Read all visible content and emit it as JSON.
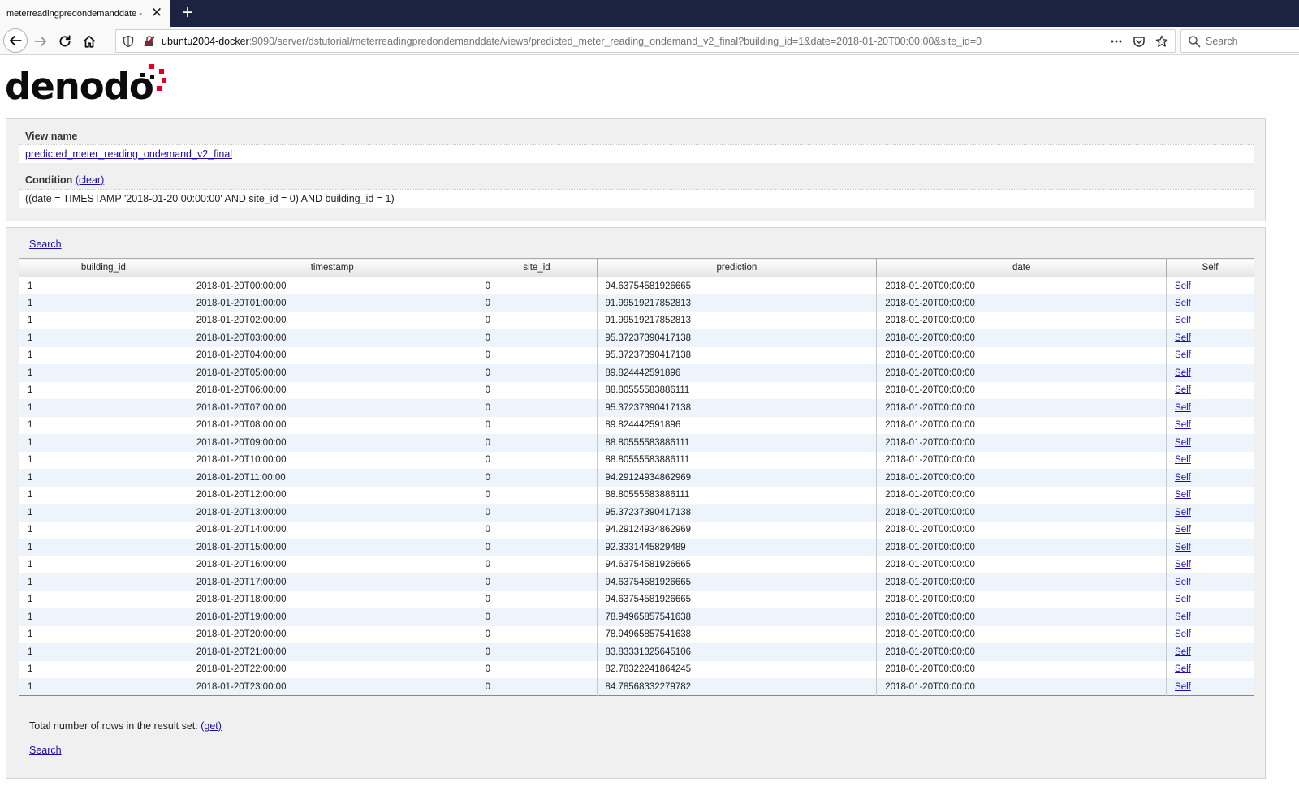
{
  "browser": {
    "tab_title": "meterreadingpredondemanddate - ",
    "url_host": "ubuntu2004-docker",
    "url_rest": ":9090/server/dstutorial/meterreadingpredondemanddate/views/predicted_meter_reading_ondemand_v2_final?building_id=1&date=2018-01-20T00:00:00&site_id=0",
    "search_placeholder": "Search"
  },
  "logo": {
    "text": "denodo"
  },
  "view": {
    "name_label": "View name",
    "name_value": "predicted_meter_reading_ondemand_v2_final",
    "condition_label": "Condition",
    "clear_label": "(clear)",
    "condition_value": "((date = TIMESTAMP '2018-01-20 00:00:00' AND site_id = 0) AND building_id = 1)"
  },
  "results": {
    "search_label": "Search",
    "total_label": "Total number of rows in the result set:",
    "get_label": "(get)",
    "columns": [
      "building_id",
      "timestamp",
      "site_id",
      "prediction",
      "date",
      "Self"
    ],
    "rows": [
      [
        "1",
        "2018-01-20T00:00:00",
        "0",
        "94.63754581926665",
        "2018-01-20T00:00:00",
        "Self"
      ],
      [
        "1",
        "2018-01-20T01:00:00",
        "0",
        "91.99519217852813",
        "2018-01-20T00:00:00",
        "Self"
      ],
      [
        "1",
        "2018-01-20T02:00:00",
        "0",
        "91.99519217852813",
        "2018-01-20T00:00:00",
        "Self"
      ],
      [
        "1",
        "2018-01-20T03:00:00",
        "0",
        "95.37237390417138",
        "2018-01-20T00:00:00",
        "Self"
      ],
      [
        "1",
        "2018-01-20T04:00:00",
        "0",
        "95.37237390417138",
        "2018-01-20T00:00:00",
        "Self"
      ],
      [
        "1",
        "2018-01-20T05:00:00",
        "0",
        "89.824442591896",
        "2018-01-20T00:00:00",
        "Self"
      ],
      [
        "1",
        "2018-01-20T06:00:00",
        "0",
        "88.80555583886111",
        "2018-01-20T00:00:00",
        "Self"
      ],
      [
        "1",
        "2018-01-20T07:00:00",
        "0",
        "95.37237390417138",
        "2018-01-20T00:00:00",
        "Self"
      ],
      [
        "1",
        "2018-01-20T08:00:00",
        "0",
        "89.824442591896",
        "2018-01-20T00:00:00",
        "Self"
      ],
      [
        "1",
        "2018-01-20T09:00:00",
        "0",
        "88.80555583886111",
        "2018-01-20T00:00:00",
        "Self"
      ],
      [
        "1",
        "2018-01-20T10:00:00",
        "0",
        "88.80555583886111",
        "2018-01-20T00:00:00",
        "Self"
      ],
      [
        "1",
        "2018-01-20T11:00:00",
        "0",
        "94.29124934862969",
        "2018-01-20T00:00:00",
        "Self"
      ],
      [
        "1",
        "2018-01-20T12:00:00",
        "0",
        "88.80555583886111",
        "2018-01-20T00:00:00",
        "Self"
      ],
      [
        "1",
        "2018-01-20T13:00:00",
        "0",
        "95.37237390417138",
        "2018-01-20T00:00:00",
        "Self"
      ],
      [
        "1",
        "2018-01-20T14:00:00",
        "0",
        "94.29124934862969",
        "2018-01-20T00:00:00",
        "Self"
      ],
      [
        "1",
        "2018-01-20T15:00:00",
        "0",
        "92.3331445829489",
        "2018-01-20T00:00:00",
        "Self"
      ],
      [
        "1",
        "2018-01-20T16:00:00",
        "0",
        "94.63754581926665",
        "2018-01-20T00:00:00",
        "Self"
      ],
      [
        "1",
        "2018-01-20T17:00:00",
        "0",
        "94.63754581926665",
        "2018-01-20T00:00:00",
        "Self"
      ],
      [
        "1",
        "2018-01-20T18:00:00",
        "0",
        "94.63754581926665",
        "2018-01-20T00:00:00",
        "Self"
      ],
      [
        "1",
        "2018-01-20T19:00:00",
        "0",
        "78.94965857541638",
        "2018-01-20T00:00:00",
        "Self"
      ],
      [
        "1",
        "2018-01-20T20:00:00",
        "0",
        "78.94965857541638",
        "2018-01-20T00:00:00",
        "Self"
      ],
      [
        "1",
        "2018-01-20T21:00:00",
        "0",
        "83.83331325645106",
        "2018-01-20T00:00:00",
        "Self"
      ],
      [
        "1",
        "2018-01-20T22:00:00",
        "0",
        "82.78322241864245",
        "2018-01-20T00:00:00",
        "Self"
      ],
      [
        "1",
        "2018-01-20T23:00:00",
        "0",
        "84.78568332279782",
        "2018-01-20T00:00:00",
        "Self"
      ]
    ]
  },
  "colors": {
    "link": "#1a0dab",
    "tabbar": "#1c2340",
    "logo_accent": "#e2001a",
    "row_stripe": "#eef4fc"
  }
}
